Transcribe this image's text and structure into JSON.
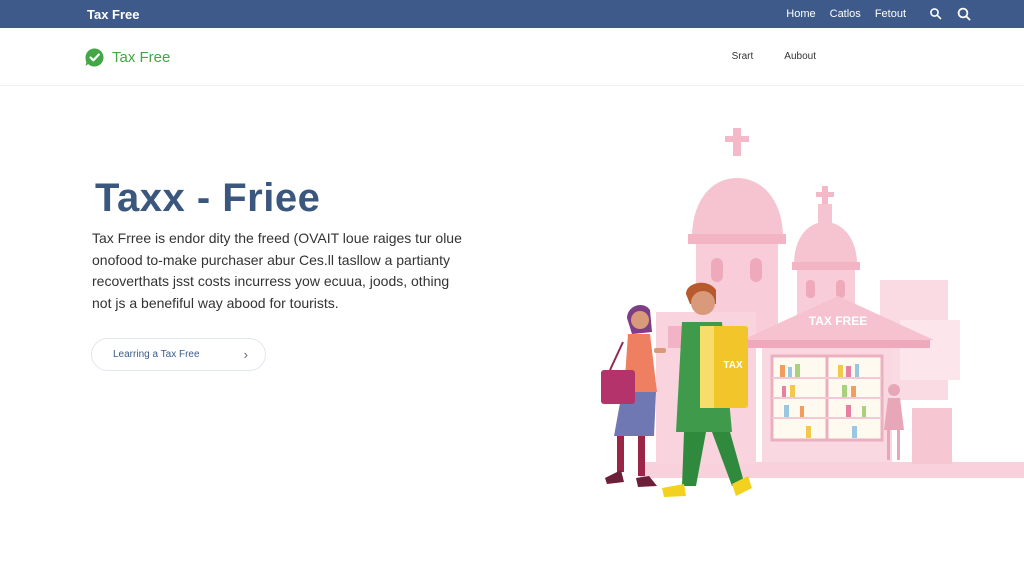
{
  "topbar": {
    "brand": "Tax Free",
    "nav": [
      "Home",
      "Catlos",
      "Fetout"
    ]
  },
  "header": {
    "logo_text": "Tax Free",
    "nav": [
      "Srart",
      "Aubout"
    ]
  },
  "hero": {
    "title": "Taxx - Friee",
    "description_lines": [
      "Tax Frree is endor dity the freed (OVAIT loue raiges tur olue",
      "onofood to-make purchaser abur Ces.ll tasllow a partianty",
      "recoverthats jsst costs incurress yow ecuua, joods, othing",
      "not js a benefiful way abood for tourists."
    ],
    "cta_label": "Learring a Tax Free",
    "cta_chevron": "›"
  },
  "illustration": {
    "shop_sign": "TAX FREE",
    "bag_label": "TAX"
  },
  "colors": {
    "topbar": "#3d5a8a",
    "brand_green": "#43a647",
    "title": "#3b577d",
    "building_pink": "#f6c7d3"
  }
}
